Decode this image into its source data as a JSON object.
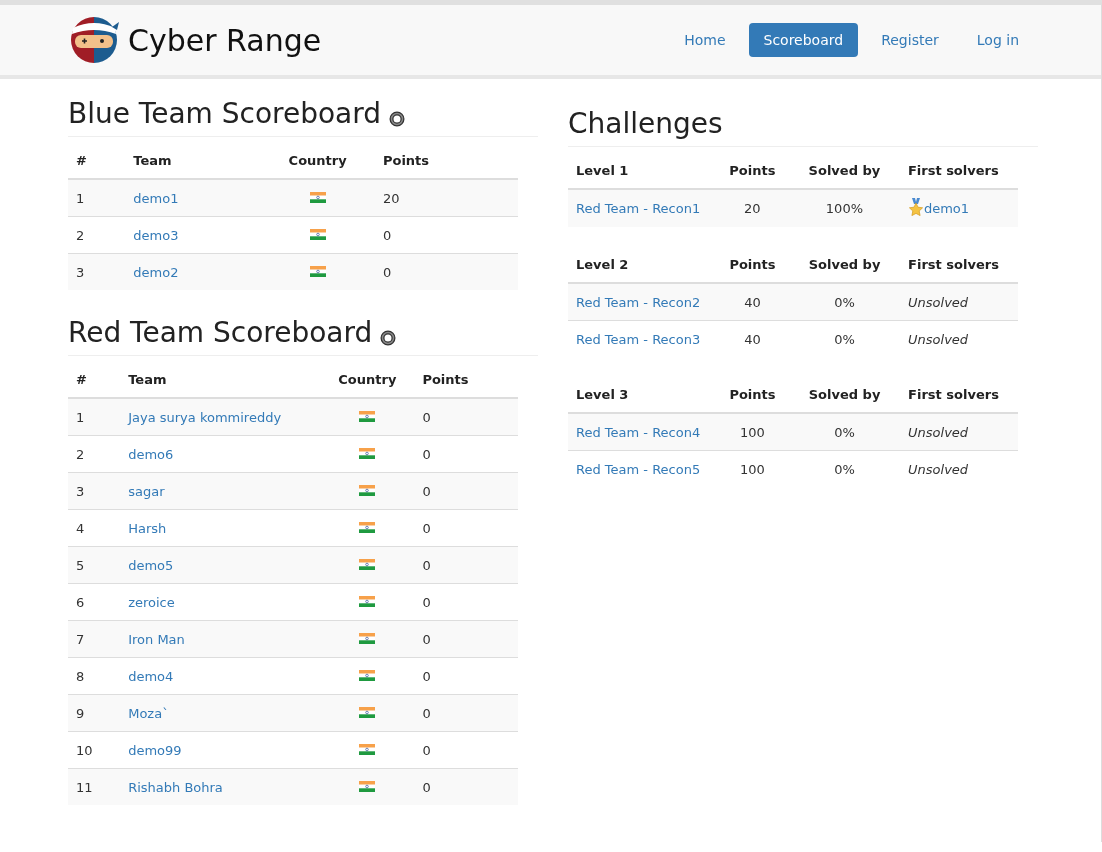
{
  "navbar": {
    "brand": "Cyber Range",
    "links": [
      {
        "label": "Home",
        "selected": false
      },
      {
        "label": "Scoreboard",
        "selected": true
      },
      {
        "label": "Register",
        "selected": false
      },
      {
        "label": "Log in",
        "selected": false
      }
    ]
  },
  "scoreboards": [
    {
      "title": "Blue Team Scoreboard",
      "columns": [
        "#",
        "Team",
        "Country",
        "Points"
      ],
      "rows": [
        {
          "rank": "1",
          "team": "demo1",
          "points": "20"
        },
        {
          "rank": "2",
          "team": "demo3",
          "points": "0"
        },
        {
          "rank": "3",
          "team": "demo2",
          "points": "0"
        }
      ]
    },
    {
      "title": "Red Team Scoreboard",
      "columns": [
        "#",
        "Team",
        "Country",
        "Points"
      ],
      "rows": [
        {
          "rank": "1",
          "team": "Jaya surya kommireddy",
          "points": "0"
        },
        {
          "rank": "2",
          "team": "demo6",
          "points": "0"
        },
        {
          "rank": "3",
          "team": "sagar",
          "points": "0"
        },
        {
          "rank": "4",
          "team": "Harsh",
          "points": "0"
        },
        {
          "rank": "5",
          "team": "demo5",
          "points": "0"
        },
        {
          "rank": "6",
          "team": "zeroice",
          "points": "0"
        },
        {
          "rank": "7",
          "team": "Iron Man",
          "points": "0"
        },
        {
          "rank": "8",
          "team": "demo4",
          "points": "0"
        },
        {
          "rank": "9",
          "team": "Moza`",
          "points": "0"
        },
        {
          "rank": "10",
          "team": "demo99",
          "points": "0"
        },
        {
          "rank": "11",
          "team": "Rishabh Bohra",
          "points": "0"
        }
      ]
    }
  ],
  "challenges": {
    "title": "Challenges",
    "levels": [
      {
        "columns": [
          "Level 1",
          "Points",
          "Solved by",
          "First solvers"
        ],
        "rows": [
          {
            "name": "Red Team - Recon1",
            "points": "20",
            "solved_by": "100%",
            "first_solver": {
              "kind": "solved",
              "text": "demo1"
            }
          }
        ]
      },
      {
        "columns": [
          "Level 2",
          "Points",
          "Solved by",
          "First solvers"
        ],
        "rows": [
          {
            "name": "Red Team - Recon2",
            "points": "40",
            "solved_by": "0%",
            "first_solver": {
              "kind": "unsolved",
              "text": "Unsolved"
            }
          },
          {
            "name": "Red Team - Recon3",
            "points": "40",
            "solved_by": "0%",
            "first_solver": {
              "kind": "unsolved",
              "text": "Unsolved"
            }
          }
        ]
      },
      {
        "columns": [
          "Level 3",
          "Points",
          "Solved by",
          "First solvers"
        ],
        "rows": [
          {
            "name": "Red Team - Recon4",
            "points": "100",
            "solved_by": "0%",
            "first_solver": {
              "kind": "unsolved",
              "text": "Unsolved"
            }
          },
          {
            "name": "Red Team - Recon5",
            "points": "100",
            "solved_by": "0%",
            "first_solver": {
              "kind": "unsolved",
              "text": "Unsolved"
            }
          }
        ]
      }
    ]
  }
}
